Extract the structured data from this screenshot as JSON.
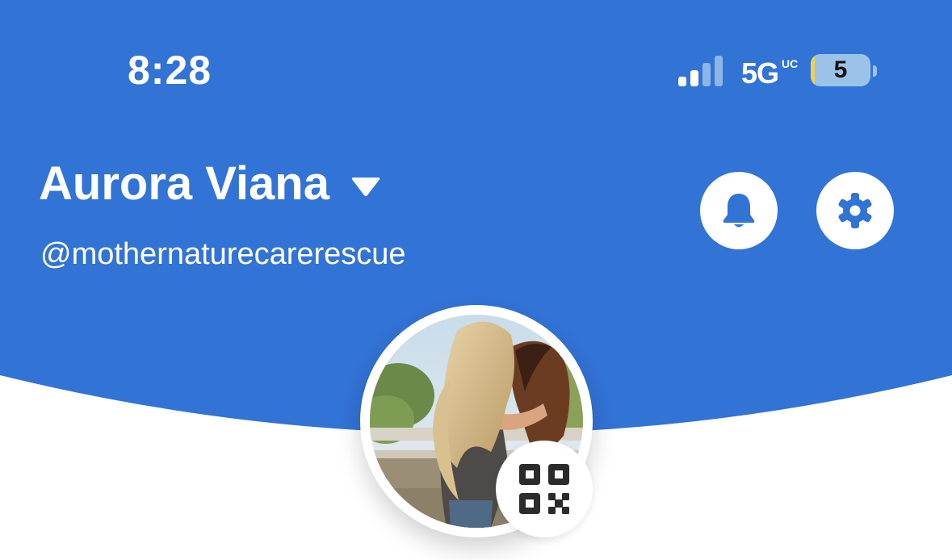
{
  "status_bar": {
    "time": "8:28",
    "network": "5G",
    "network_badge": "UC",
    "battery": "5",
    "signal_icon": "cellular-signal-icon"
  },
  "profile": {
    "display_name": "Aurora Viana",
    "username": "@mothernaturecarerescue",
    "avatar_description": "avatar-photo"
  },
  "actions": {
    "notifications_icon": "bell-icon",
    "settings_icon": "gear-icon",
    "qr_icon": "qr-code-icon"
  },
  "colors": {
    "header_blue": "#3273d6",
    "white": "#ffffff",
    "battery_bg": "#9bc3ea",
    "battery_low": "#f2cf4c"
  }
}
